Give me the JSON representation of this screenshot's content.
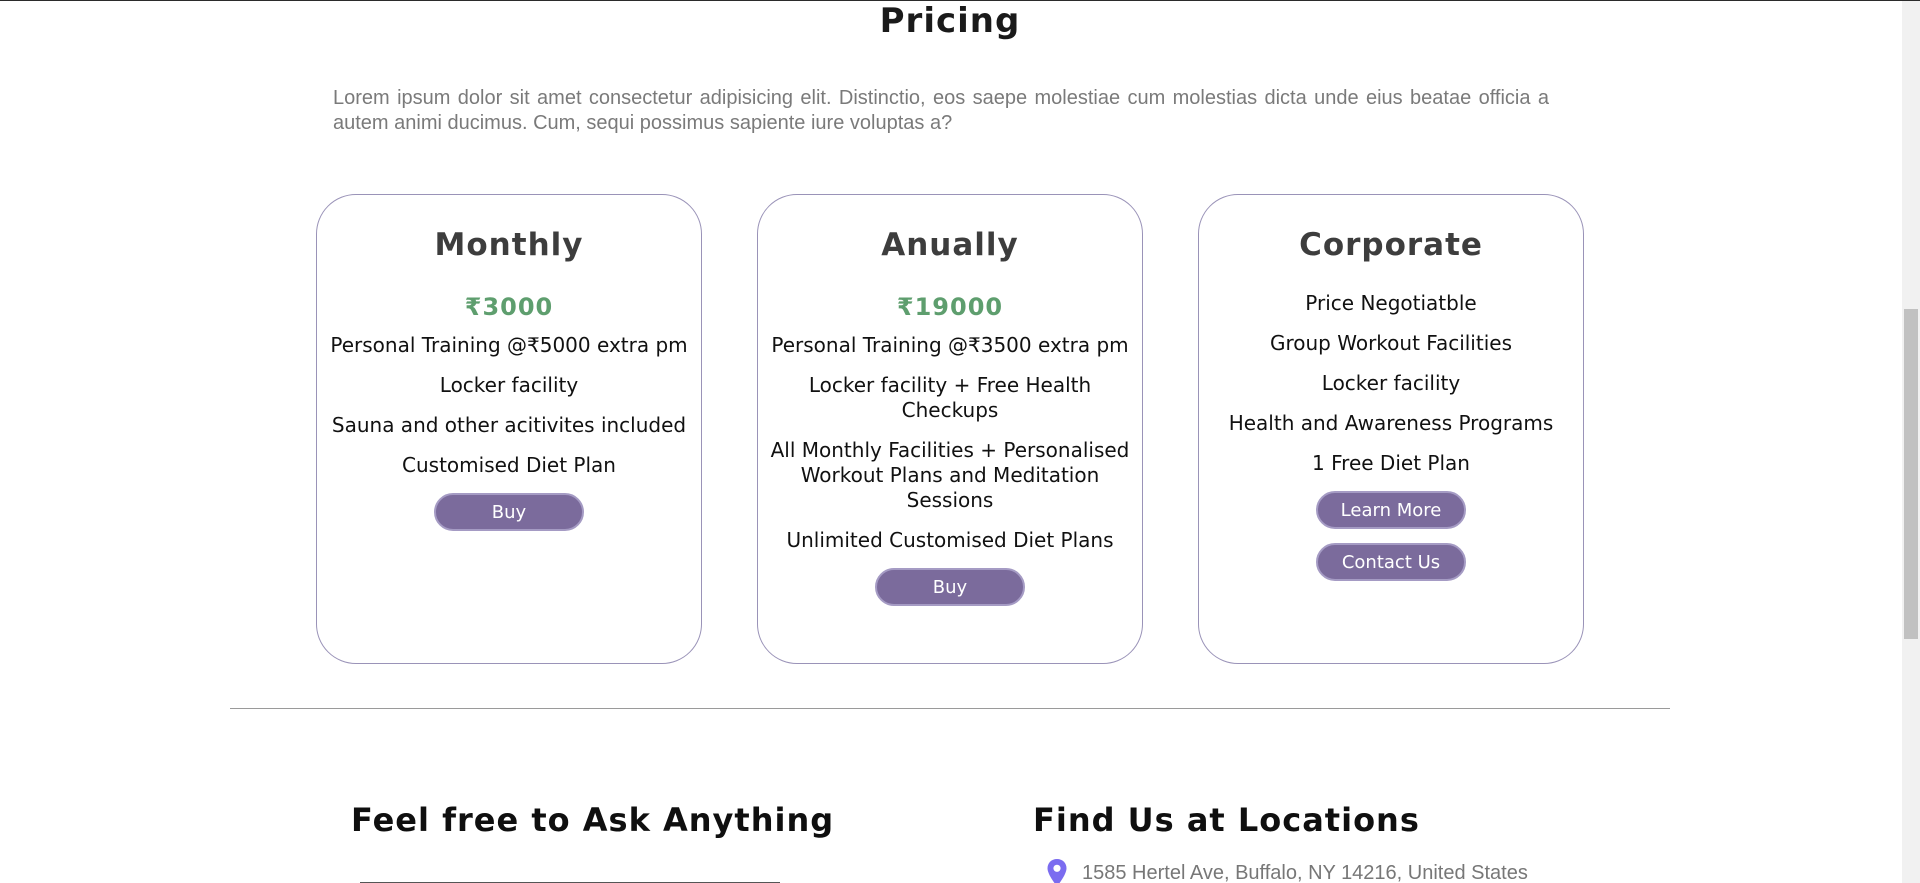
{
  "pricing": {
    "title": "Pricing",
    "intro": "Lorem ipsum dolor sit amet consectetur adipisicing elit. Distinctio, eos saepe molestiae cum molestias dicta unde eius beatae officia a autem animi ducimus. Cum, sequi possimus sapiente iure voluptas a?"
  },
  "plans": [
    {
      "name": "Monthly",
      "price": "₹3000",
      "features": [
        "Personal Training @₹5000 extra pm",
        "Locker facility",
        "Sauna and other acitivites included",
        "Customised Diet Plan"
      ],
      "button": "Buy"
    },
    {
      "name": "Anually",
      "price": "₹19000",
      "features": [
        "Personal Training @₹3500 extra pm",
        "Locker facility + Free Health Checkups",
        "All Monthly Facilities + Personalised Workout Plans and Meditation Sessions",
        "Unlimited Customised Diet Plans"
      ],
      "button": "Buy"
    },
    {
      "name": "Corporate",
      "features": [
        "Price Negotiatble",
        "Group Workout Facilities",
        "Locker facility",
        "Health and Awareness Programs",
        "1 Free Diet Plan"
      ],
      "buttons": [
        "Learn More",
        "Contact Us"
      ]
    }
  ],
  "contact": {
    "ask_title": "Feel free to Ask Anything",
    "locations_title": "Find Us at Locations",
    "address": "1585 Hertel Ave, Buffalo, NY 14216, United States"
  },
  "icons": {
    "location": "map-pin-icon"
  },
  "colors": {
    "accent_button": "#7b6b9c",
    "price_green": "#5e9e6e",
    "card_border": "#9a93b8",
    "pin": "#7b6cf0"
  }
}
